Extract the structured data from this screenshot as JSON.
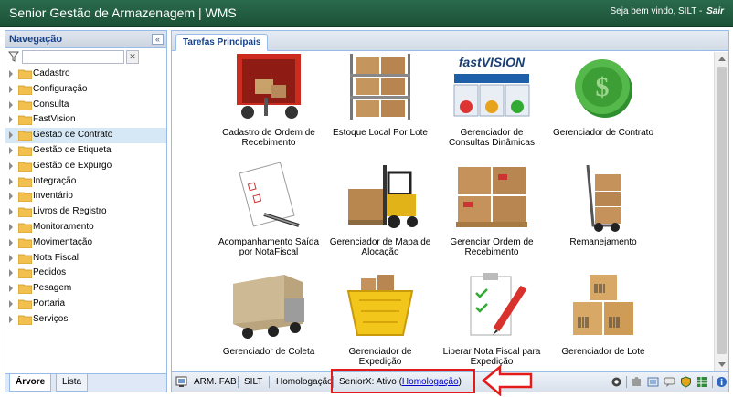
{
  "header": {
    "title": "Senior Gestão de Armazenagem | WMS",
    "welcome": "Seja bem vindo, SILT -",
    "logout": "Sair"
  },
  "nav": {
    "title": "Navegação",
    "collapse_glyph": "«",
    "filter_placeholder": "",
    "clear_glyph": "✕",
    "items": [
      {
        "label": "Cadastro"
      },
      {
        "label": "Configuração"
      },
      {
        "label": "Consulta"
      },
      {
        "label": "FastVision"
      },
      {
        "label": "Gestao de Contrato"
      },
      {
        "label": "Gestão de Etiqueta"
      },
      {
        "label": "Gestão de Expurgo"
      },
      {
        "label": "Integração"
      },
      {
        "label": "Inventário"
      },
      {
        "label": "Livros de Registro"
      },
      {
        "label": "Monitoramento"
      },
      {
        "label": "Movimentação"
      },
      {
        "label": "Nota Fiscal"
      },
      {
        "label": "Pedidos"
      },
      {
        "label": "Pesagem"
      },
      {
        "label": "Portaria"
      },
      {
        "label": "Serviços"
      }
    ],
    "selected_item": "Gestao de Contrato",
    "tabs": [
      {
        "label": "Árvore"
      },
      {
        "label": "Lista"
      }
    ]
  },
  "main": {
    "tab": "Tarefas Principais",
    "tiles": [
      {
        "caption": "Cadastro de Ordem de Recebimento",
        "icon": "truck-loading-icon"
      },
      {
        "caption": "Estoque Local Por Lote",
        "icon": "storage-rack-icon"
      },
      {
        "caption": "Gerenciador de Consultas Dinâmicas",
        "icon": "fastvision-dashboard-icon",
        "logo_text": "fastVISION"
      },
      {
        "caption": "Gerenciador de Contrato",
        "icon": "dollar-coin-icon"
      },
      {
        "caption": "Acompanhamento Saída por NotaFiscal",
        "icon": "checklist-pen-icon"
      },
      {
        "caption": "Gerenciador de Mapa de Alocação",
        "icon": "forklift-icon"
      },
      {
        "caption": "Gerenciar Ordem de Recebimento",
        "icon": "boxes-pallet-icon"
      },
      {
        "caption": "Remanejamento",
        "icon": "hand-truck-icon"
      },
      {
        "caption": "Gerenciador de Coleta",
        "icon": "container-truck-icon"
      },
      {
        "caption": "Gerenciador de Expedição",
        "icon": "shopping-basket-icon"
      },
      {
        "caption": "Liberar Nota Fiscal para Expedição",
        "icon": "clipboard-check-icon"
      },
      {
        "caption": "Gerenciador de Lote",
        "icon": "barcode-boxes-icon"
      }
    ]
  },
  "status": {
    "unit": "ARM. FAB",
    "user": "SILT",
    "environment": "Homologação",
    "seniorx_label": "SeniorX: Ativo (",
    "seniorx_link": "Homologação",
    "seniorx_close": ")"
  },
  "colors": {
    "titlebar": "#1f5a3d",
    "panel_border": "#99bbe8",
    "highlight": "#e31b1b"
  }
}
